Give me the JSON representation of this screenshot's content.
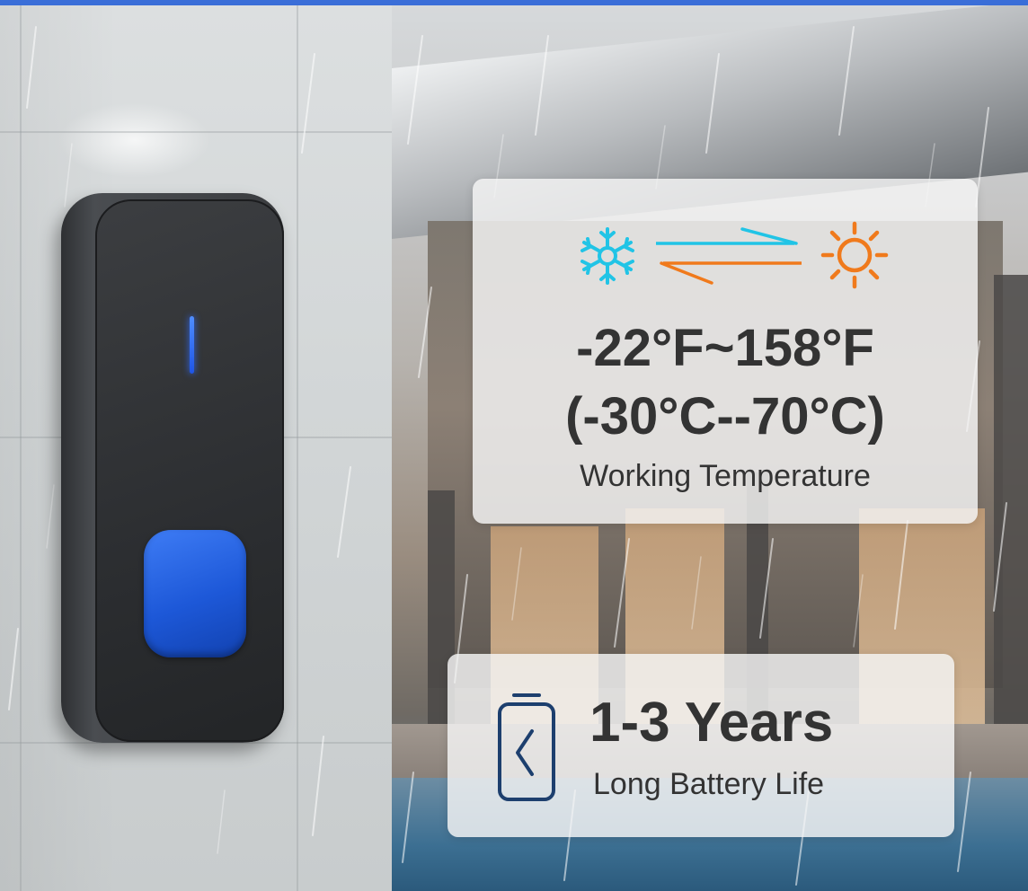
{
  "temperature": {
    "fahrenheit": "-22°F~158°F",
    "celsius": "(-30°C--70°C)",
    "label": "Working Temperature"
  },
  "battery": {
    "years": "1-3 Years",
    "label": "Long Battery Life"
  },
  "icons": {
    "cold": "snowflake-icon",
    "hot": "sun-icon",
    "exchange": "exchange-arrows-icon",
    "battery": "battery-icon"
  },
  "colors": {
    "accent_blue": "#2f6cff",
    "cold_cyan": "#21c4e6",
    "hot_orange": "#f07a1c",
    "battery_navy": "#1d3f6e",
    "text_dark": "#333333"
  }
}
